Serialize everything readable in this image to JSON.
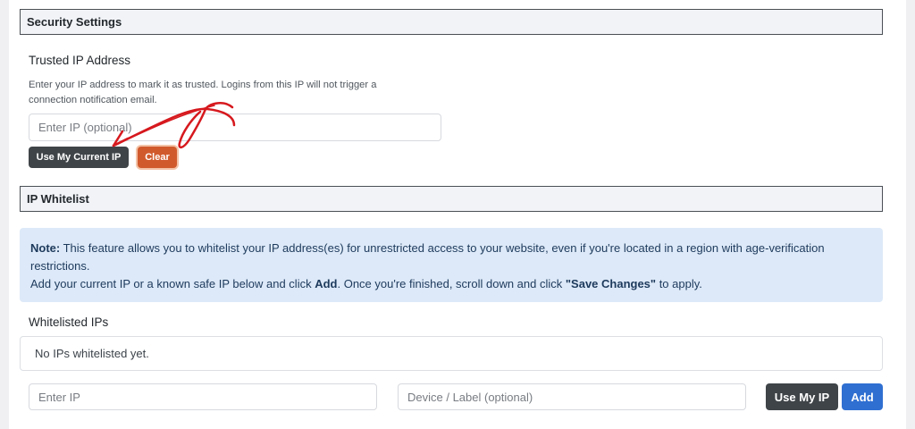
{
  "security": {
    "header": "Security Settings",
    "trusted_ip_title": "Trusted IP Address",
    "trusted_ip_desc": "Enter your IP address to mark it as trusted. Logins from this IP will not trigger a connection notification email.",
    "trusted_ip_placeholder": "Enter IP (optional)",
    "use_current_ip_label": "Use My Current IP",
    "clear_label": "Clear"
  },
  "whitelist": {
    "header": "IP Whitelist",
    "note": {
      "lead": "Note:",
      "line1": " This feature allows you to whitelist your IP address(es) for unrestricted access to your website, even if you're located in a region with age-verification restrictions.",
      "line2a": "Add your current IP or a known safe IP below and click ",
      "add_word": "Add",
      "line2b": ". Once you're finished, scroll down and click ",
      "save_changes": "\"Save Changes\"",
      "line2c": " to apply."
    },
    "list_title": "Whitelisted IPs",
    "empty_text": "No IPs whitelisted yet.",
    "ip_placeholder": "Enter IP",
    "label_placeholder": "Device / Label (optional)",
    "use_my_ip_label": "Use My IP",
    "add_label": "Add"
  },
  "colors": {
    "annotation_red": "#d6191e",
    "clear_button": "#d15a2c",
    "add_button": "#2f6fd1",
    "note_bg": "#dde9f8"
  }
}
